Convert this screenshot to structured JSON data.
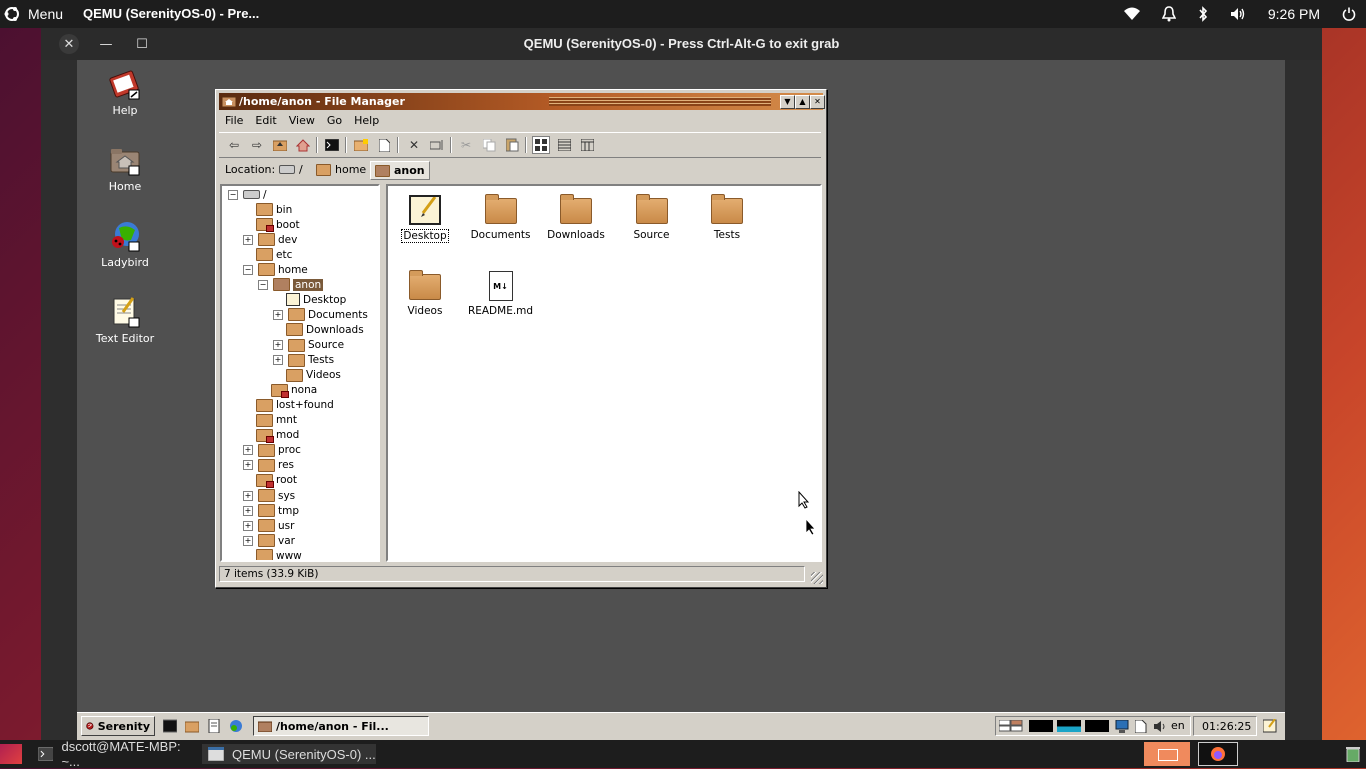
{
  "top_panel": {
    "menu_label": "Menu",
    "active_title": "QEMU (SerenityOS-0) - Pre...",
    "clock": "9:26 PM"
  },
  "qemu": {
    "title": "QEMU (SerenityOS-0) - Press Ctrl-Alt-G to exit grab"
  },
  "desktop_icons": [
    {
      "label": "Help",
      "icon": "help-book-icon"
    },
    {
      "label": "Home",
      "icon": "home-folder-icon"
    },
    {
      "label": "Ladybird",
      "icon": "ladybird-browser-icon"
    },
    {
      "label": "Text Editor",
      "icon": "text-editor-icon"
    }
  ],
  "file_manager": {
    "title": "/home/anon - File Manager",
    "menu": [
      "File",
      "Edit",
      "View",
      "Go",
      "Help"
    ],
    "location_label": "Location:",
    "breadcrumbs": [
      "/",
      "home",
      "anon"
    ],
    "tree": [
      {
        "label": "/",
        "depth": 0,
        "expander": "minus",
        "icon": "drive"
      },
      {
        "label": "bin",
        "depth": 1,
        "expander": "none",
        "icon": "folder"
      },
      {
        "label": "boot",
        "depth": 1,
        "expander": "none",
        "icon": "folder-locked"
      },
      {
        "label": "dev",
        "depth": 1,
        "expander": "plus",
        "icon": "folder"
      },
      {
        "label": "etc",
        "depth": 1,
        "expander": "none",
        "icon": "folder"
      },
      {
        "label": "home",
        "depth": 1,
        "expander": "minus",
        "icon": "folder"
      },
      {
        "label": "anon",
        "depth": 2,
        "expander": "minus",
        "icon": "home-folder",
        "selected": true
      },
      {
        "label": "Desktop",
        "depth": 3,
        "expander": "none",
        "icon": "desktop"
      },
      {
        "label": "Documents",
        "depth": 3,
        "expander": "plus",
        "icon": "folder"
      },
      {
        "label": "Downloads",
        "depth": 3,
        "expander": "none",
        "icon": "folder"
      },
      {
        "label": "Source",
        "depth": 3,
        "expander": "plus",
        "icon": "folder"
      },
      {
        "label": "Tests",
        "depth": 3,
        "expander": "plus",
        "icon": "folder"
      },
      {
        "label": "Videos",
        "depth": 3,
        "expander": "none",
        "icon": "folder"
      },
      {
        "label": "nona",
        "depth": 2,
        "expander": "none",
        "icon": "folder-locked"
      },
      {
        "label": "lost+found",
        "depth": 1,
        "expander": "none",
        "icon": "folder"
      },
      {
        "label": "mnt",
        "depth": 1,
        "expander": "none",
        "icon": "folder"
      },
      {
        "label": "mod",
        "depth": 1,
        "expander": "none",
        "icon": "folder-locked"
      },
      {
        "label": "proc",
        "depth": 1,
        "expander": "plus",
        "icon": "folder"
      },
      {
        "label": "res",
        "depth": 1,
        "expander": "plus",
        "icon": "folder"
      },
      {
        "label": "root",
        "depth": 1,
        "expander": "none",
        "icon": "folder-locked"
      },
      {
        "label": "sys",
        "depth": 1,
        "expander": "plus",
        "icon": "folder"
      },
      {
        "label": "tmp",
        "depth": 1,
        "expander": "plus",
        "icon": "folder"
      },
      {
        "label": "usr",
        "depth": 1,
        "expander": "plus",
        "icon": "folder"
      },
      {
        "label": "var",
        "depth": 1,
        "expander": "plus",
        "icon": "folder"
      },
      {
        "label": "www",
        "depth": 1,
        "expander": "none",
        "icon": "folder"
      }
    ],
    "items": [
      {
        "label": "Desktop",
        "kind": "desktop"
      },
      {
        "label": "Documents",
        "kind": "folder"
      },
      {
        "label": "Downloads",
        "kind": "folder"
      },
      {
        "label": "Source",
        "kind": "folder"
      },
      {
        "label": "Tests",
        "kind": "folder"
      },
      {
        "label": "Videos",
        "kind": "folder"
      },
      {
        "label": "README.md",
        "kind": "markdown"
      }
    ],
    "status": "7 items (33.9 KiB)"
  },
  "serenity_taskbar": {
    "start_label": "Serenity",
    "window_button": "/home/anon - Fil...",
    "keymap": "en",
    "clock": "01:26:25"
  },
  "bottom_panel": {
    "terminal_task": "dscott@MATE-MBP: ~...",
    "qemu_task": "QEMU (SerenityOS-0) ..."
  }
}
